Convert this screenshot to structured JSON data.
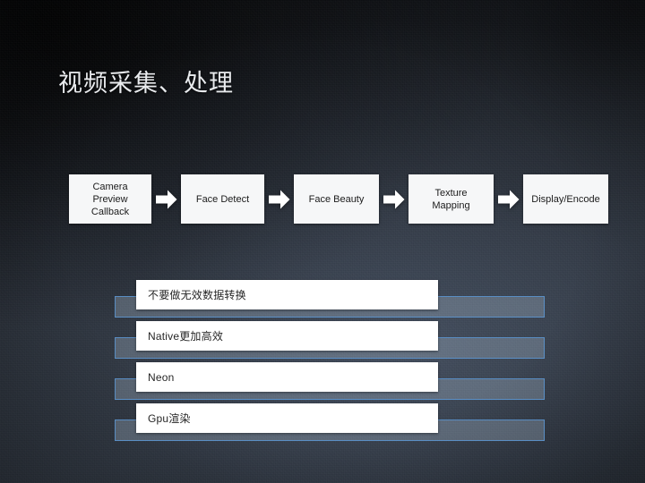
{
  "slide": {
    "title": "视频采集、处理",
    "background_color": "#2b3038",
    "accent_color": "#5a8ec4",
    "box_fill_color": "#f6f7f8",
    "box_text_color": "#1b1b1b",
    "title_color": "#e9ebee"
  },
  "flow": {
    "arrow_icon": "arrow-right-block-icon",
    "steps": [
      {
        "label": "Camera\nPreview\nCallback",
        "line1": "Camera",
        "line2": "Preview",
        "line3": "Callback"
      },
      {
        "label": "Face Detect",
        "line1": "Face Detect",
        "line2": "",
        "line3": ""
      },
      {
        "label": "Face Beauty",
        "line1": "Face Beauty",
        "line2": "",
        "line3": ""
      },
      {
        "label": "Texture Mapping",
        "line1": "Texture",
        "line2": "Mapping",
        "line3": ""
      },
      {
        "label": "Display/Encode",
        "line1": "Display/Encode",
        "line2": "",
        "line3": ""
      }
    ]
  },
  "bullets": {
    "items": [
      {
        "label": "不要做无效数据转换"
      },
      {
        "label": "Native更加高效"
      },
      {
        "label": "Neon"
      },
      {
        "label": "Gpu渲染"
      }
    ]
  }
}
